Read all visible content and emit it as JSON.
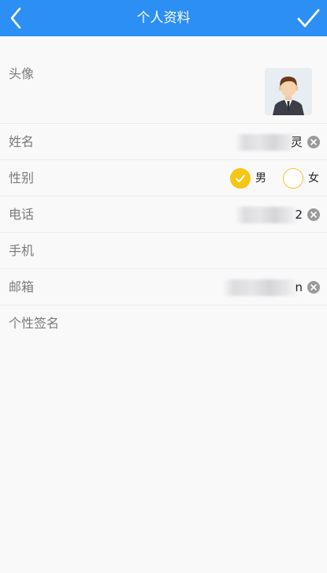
{
  "header": {
    "title": "个人资料",
    "back_icon": "chevron-left-icon",
    "done_icon": "check-icon",
    "background": "#2b8ff3"
  },
  "form": {
    "avatar": {
      "label": "头像",
      "icon": "user-avatar-icon"
    },
    "name": {
      "label": "姓名",
      "value_visible": "灵"
    },
    "gender": {
      "label": "性别",
      "options": [
        {
          "label": "男",
          "checked": true
        },
        {
          "label": "女",
          "checked": false
        }
      ],
      "accent": "#f7c513"
    },
    "phone": {
      "label": "电话",
      "value_visible": "2"
    },
    "mobile": {
      "label": "手机",
      "value_visible": ""
    },
    "email": {
      "label": "邮箱",
      "value_visible": "n"
    },
    "signature": {
      "label": "个性签名"
    }
  }
}
